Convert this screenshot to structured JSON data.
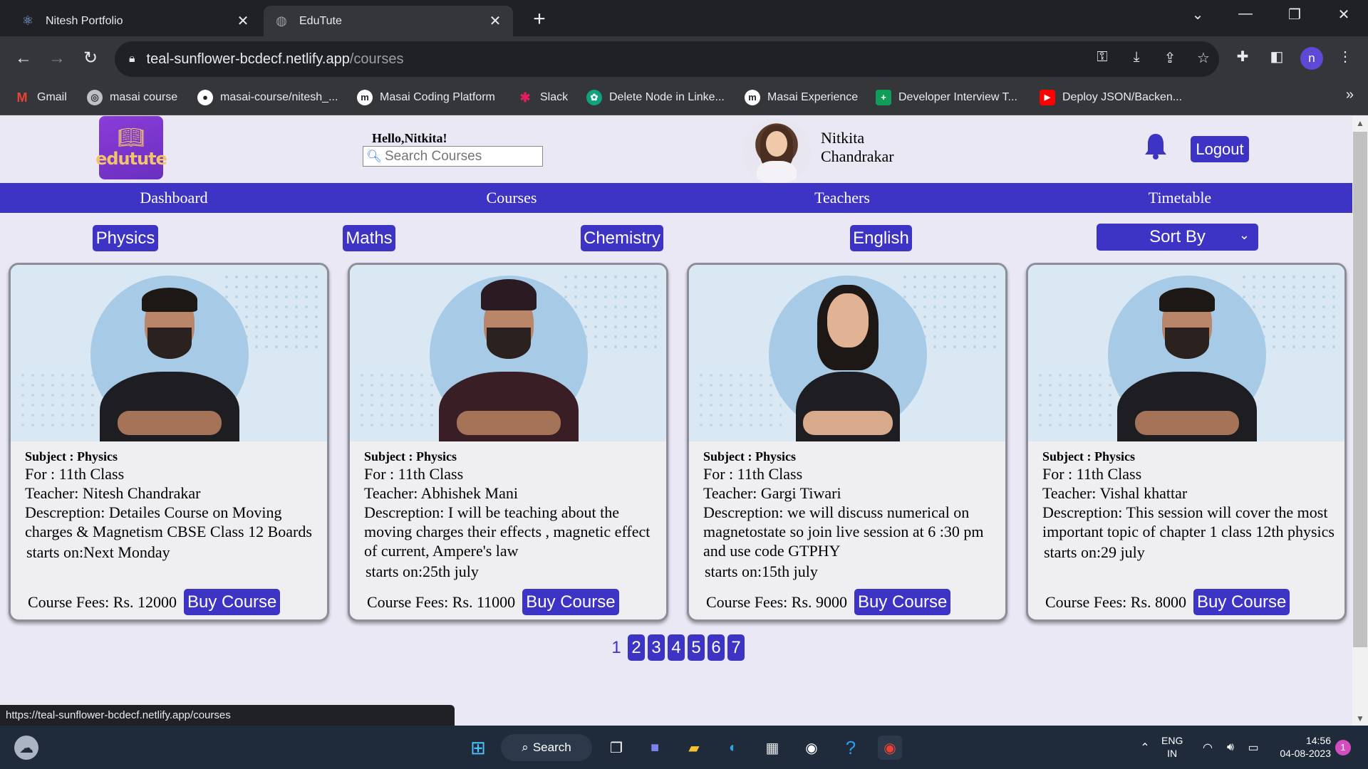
{
  "browser": {
    "tabs": [
      {
        "title": "Nitesh Portfolio",
        "icon": "react-icon"
      },
      {
        "title": "EduTute",
        "icon": "globe-icon"
      }
    ],
    "url_host": "teal-sunflower-bcdecf.netlify.app",
    "url_path": "/courses",
    "bookmarks": [
      {
        "label": "Gmail",
        "icon": "gmail-icon"
      },
      {
        "label": "masai course",
        "icon": "chrome-icon"
      },
      {
        "label": "masai-course/nitesh_...",
        "icon": "github-icon"
      },
      {
        "label": "Masai Coding Platform",
        "icon": "masai-icon"
      },
      {
        "label": "Slack",
        "icon": "slack-icon"
      },
      {
        "label": "Delete Node in Linke...",
        "icon": "chatgpt-icon"
      },
      {
        "label": "Masai Experience",
        "icon": "masai-icon"
      },
      {
        "label": "Developer Interview T...",
        "icon": "sheets-icon"
      },
      {
        "label": "Deploy JSON/Backen...",
        "icon": "youtube-icon"
      }
    ],
    "profile_initial": "n",
    "status_url": "https://teal-sunflower-bcdecf.netlify.app/courses"
  },
  "header": {
    "logo_text": "edutute",
    "greeting": "Hello,Nitkita!",
    "search_placeholder": "Search Courses",
    "user_first": "Nitkita",
    "user_last": "Chandrakar",
    "logout_label": "Logout"
  },
  "nav": [
    "Dashboard",
    "Courses",
    "Teachers",
    "Timetable"
  ],
  "filters": [
    "Physics",
    "Maths",
    "Chemistry",
    "English"
  ],
  "sort_label": "Sort By",
  "courses": [
    {
      "subject": "Subject : Physics",
      "for": "For : 11th Class",
      "teacher": "Teacher: Nitesh Chandrakar",
      "description": "Descreption: Detailes Course on Moving charges & Magnetism CBSE Class 12 Boards",
      "starts": "starts on:Next Monday",
      "fees": "Course Fees: Rs. 12000",
      "buy_label": "Buy Course"
    },
    {
      "subject": "Subject : Physics",
      "for": "For : 11th Class",
      "teacher": "Teacher: Abhishek Mani",
      "description": "Descreption: I will be teaching about the moving charges their effects , magnetic effect of current, Ampere's law",
      "starts": "starts on:25th july",
      "fees": "Course Fees: Rs. 11000",
      "buy_label": "Buy Course"
    },
    {
      "subject": "Subject : Physics",
      "for": "For : 11th Class",
      "teacher": "Teacher: Gargi Tiwari",
      "description": "Descreption: we will discuss numerical on magnetostate so join live session at 6 :30 pm and use code GTPHY",
      "starts": "starts on:15th july",
      "fees": "Course Fees: Rs. 9000",
      "buy_label": "Buy Course"
    },
    {
      "subject": "Subject : Physics",
      "for": "For : 11th Class",
      "teacher": "Teacher: Vishal khattar",
      "description": "Descreption: This session will cover the most important topic of chapter 1 class 12th physics",
      "starts": "starts on:29 july",
      "fees": "Course Fees: Rs. 8000",
      "buy_label": "Buy Course"
    }
  ],
  "pagination": {
    "current": "1",
    "pages": [
      "1",
      "2",
      "3",
      "4",
      "5",
      "6",
      "7"
    ]
  },
  "taskbar": {
    "search_label": "Search",
    "lang_top": "ENG",
    "lang_bottom": "IN",
    "time": "14:56",
    "date": "04-08-2023",
    "notification_count": "1"
  },
  "colors": {
    "accent": "#3d33c4",
    "page_bg": "#e9e8f4"
  }
}
